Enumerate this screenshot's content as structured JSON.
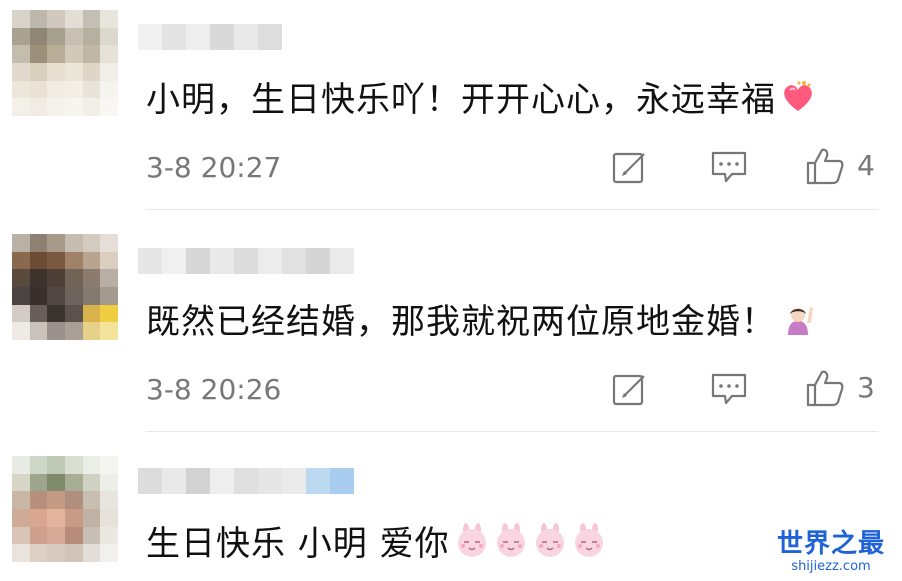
{
  "comments": [
    {
      "text": "小明，生日快乐吖！开开心心，永远幸福",
      "emoji": "heart-emoji",
      "time": "3-8 20:27",
      "likes": "4"
    },
    {
      "text": "既然已经结婚，那我就祝两位原地金婚！",
      "emoji": "raised-hand-person-emoji",
      "time": "3-8 20:26",
      "likes": "3"
    },
    {
      "text": "生日快乐 小明 爱你",
      "emoji": "bunny-face-emoji-x4",
      "time": "",
      "likes": ""
    }
  ],
  "icons": {
    "repost": "repost-icon",
    "comment": "comment-icon",
    "like": "thumbs-up-icon"
  },
  "watermark": {
    "title": "世界之最",
    "url": "shijiezz.com"
  },
  "colors": {
    "meta_text": "#777777",
    "watermark": "#1f63d6",
    "divider": "#e8e8e8"
  }
}
